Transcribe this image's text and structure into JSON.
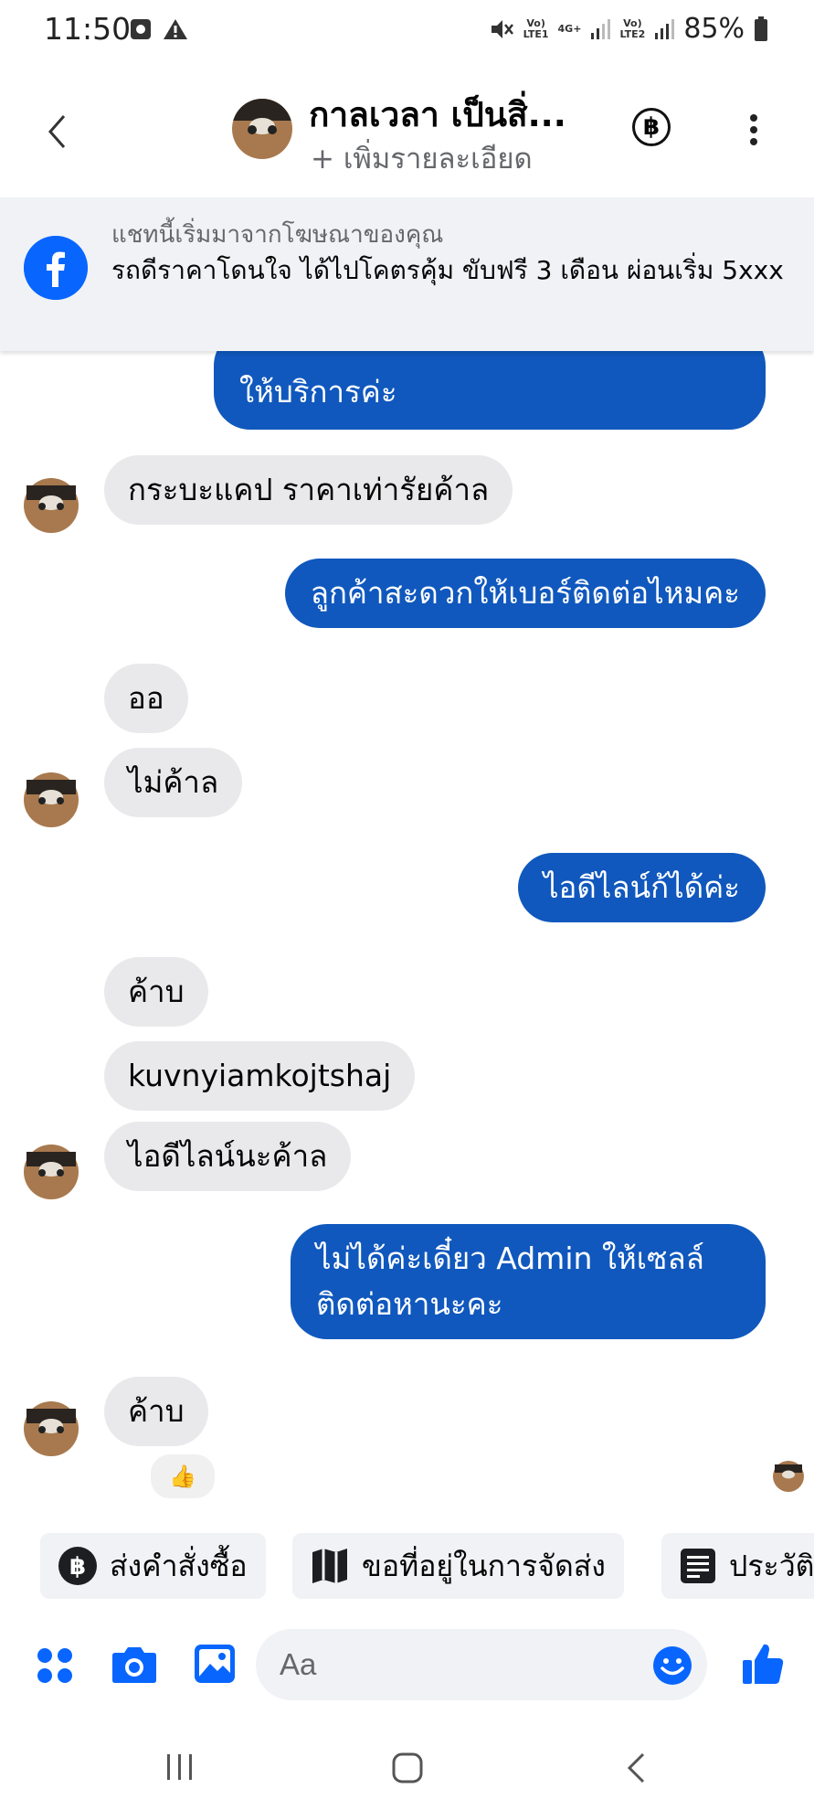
{
  "status_bar": {
    "time": "11:50",
    "net1_top": "Vo)",
    "net1_bottom": "LTE1",
    "net_type": "4G+",
    "net2_top": "Vo)",
    "net2_bottom": "LTE2",
    "battery": "85%"
  },
  "header": {
    "title": "กาลเวลา เป็นสิ่...",
    "subtitle": "+ เพิ่มรายละเอียด",
    "currency_symbol": "฿"
  },
  "ad_banner": {
    "caption": "แชทนี้เริ่มมาจากโฆษณาของคุณ",
    "text": "รถดีราคาโดนใจ ได้ไปโคตรคุ้ม ขับฟรี 3 เดือน ผ่อนเริ่ม 5xxx"
  },
  "messages": [
    {
      "side": "out",
      "text": "ให้บริการค่ะ"
    },
    {
      "side": "in",
      "text": "กระบะแคป ราคาเท่ารัยค้าล"
    },
    {
      "side": "out",
      "text": "ลูกค้าสะดวกให้เบอร์ติดต่อไหมคะ"
    },
    {
      "side": "in",
      "text": "ออ"
    },
    {
      "side": "in",
      "text": "ไม่ค้าล"
    },
    {
      "side": "out",
      "text": "ไอดีไลน์ก้ได้ค่ะ"
    },
    {
      "side": "in",
      "text": "ค้าบ"
    },
    {
      "side": "in",
      "text": "kuvnyiamkojtshaj"
    },
    {
      "side": "in",
      "text": "ไอดีไลน์นะค้าล"
    },
    {
      "side": "out",
      "text": "ไม่ได้ค่ะเดี๋ยว Admin ให้เซลล์ติดต่อหานะคะ"
    },
    {
      "side": "in",
      "text": "ค้าบ"
    }
  ],
  "reaction": "👍",
  "quick_replies": [
    {
      "icon": "baht-icon",
      "label": "ส่งคำสั่งซื้อ"
    },
    {
      "icon": "map-icon",
      "label": "ขอที่อยู่ในการจัดส่ง"
    },
    {
      "icon": "document-icon",
      "label": "ประวัติ"
    }
  ],
  "composer": {
    "placeholder": "Aa"
  },
  "colors": {
    "accent": "#0866ff",
    "outgoing_bubble": "#1058bd",
    "incoming_bubble": "#e9e9eb"
  }
}
